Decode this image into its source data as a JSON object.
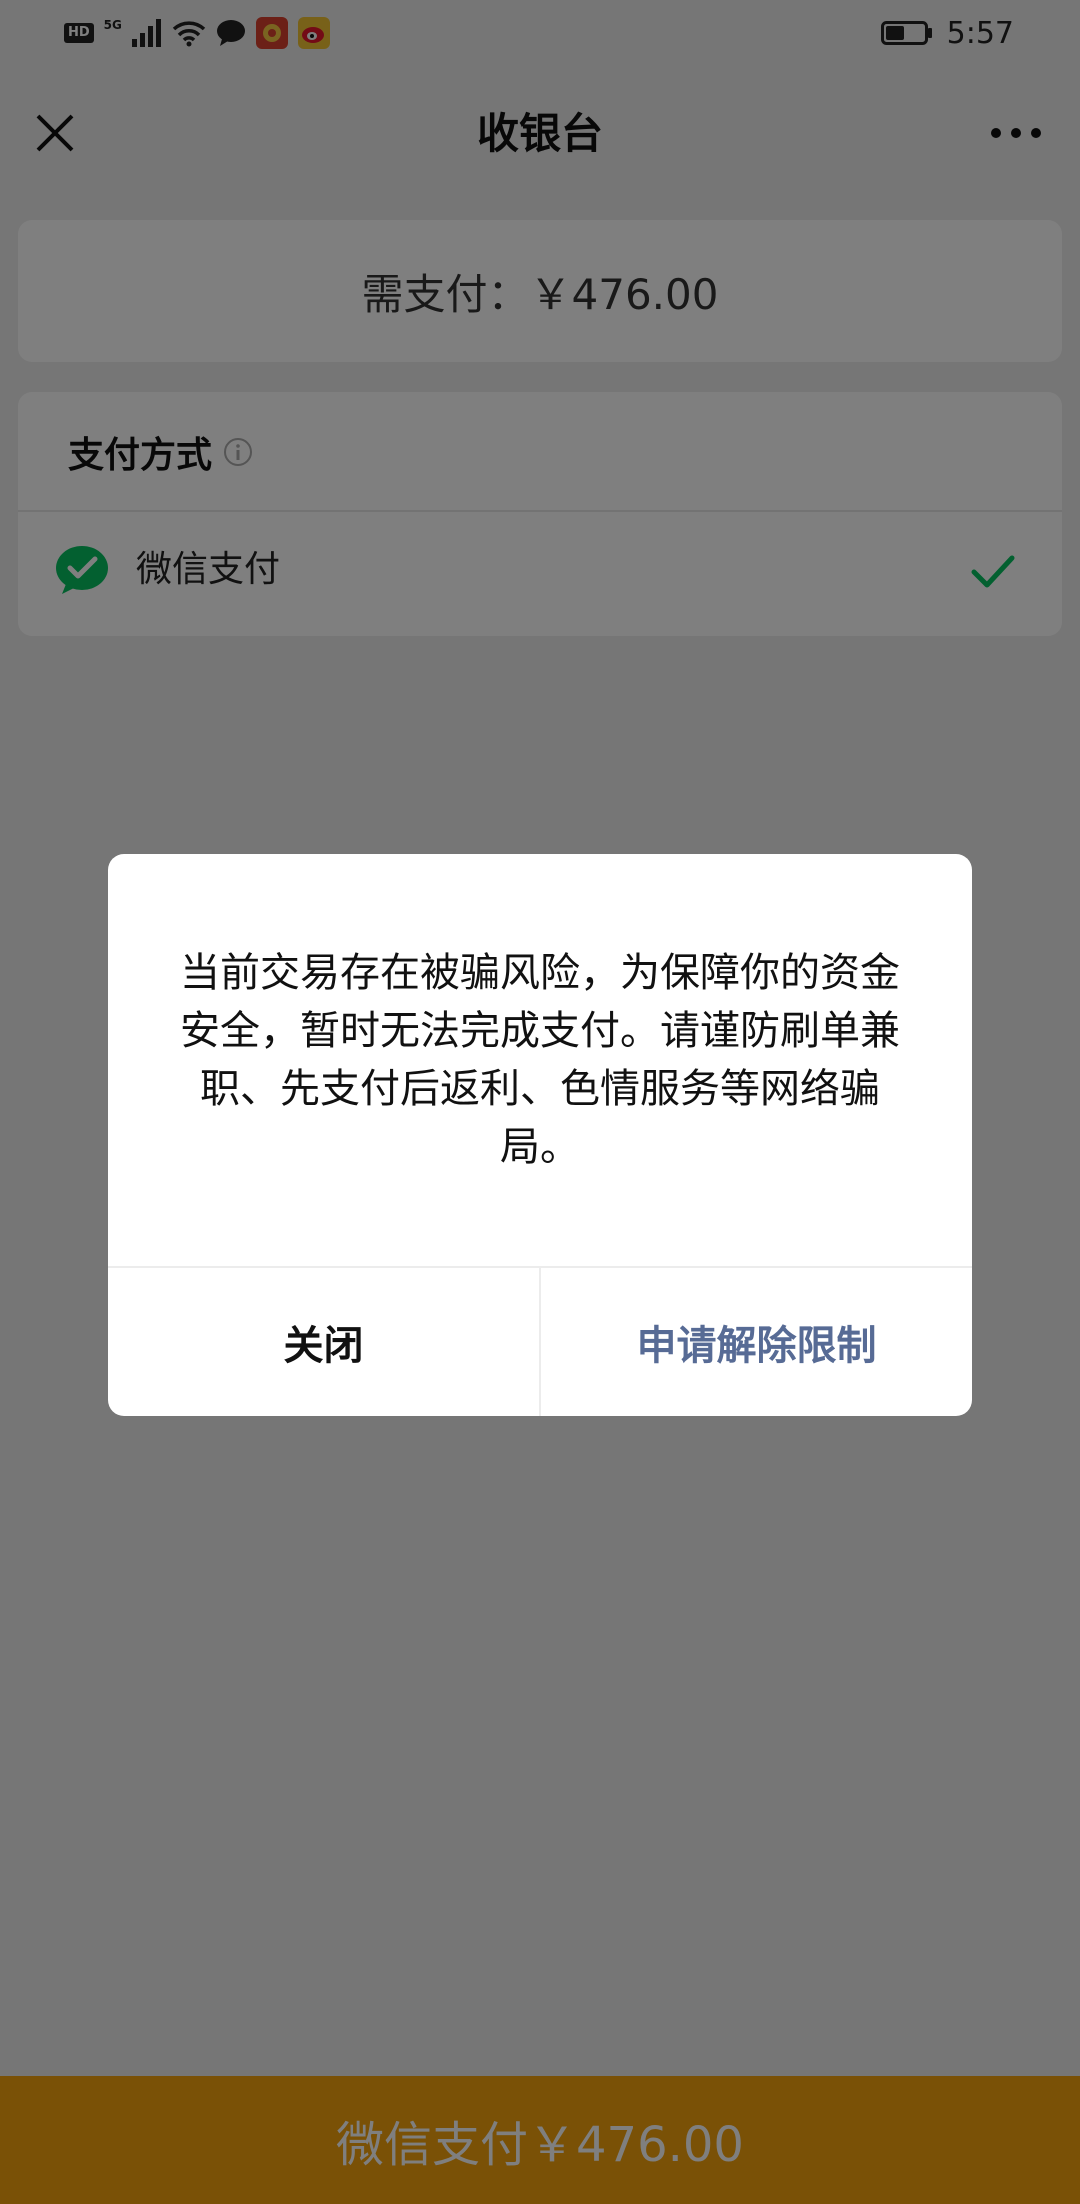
{
  "status_bar": {
    "hd_badge": "HD",
    "network": "5G",
    "time": "5:57"
  },
  "navbar": {
    "title": "收银台"
  },
  "amount": {
    "text": "需支付：￥476.00"
  },
  "payment_method": {
    "title": "支付方式",
    "option": "微信支付"
  },
  "dialog": {
    "message": "当前交易存在被骗风险，为保障你的资金安全，暂时无法完成支付。请谨防刷单兼职、先支付后返利、色情服务等网络骗局。",
    "close_label": "关闭",
    "unlock_label": "申请解除限制"
  },
  "pay_button": {
    "label": "微信支付￥476.00"
  },
  "colors": {
    "pay_bar": "#f4a30c",
    "link": "#576b95",
    "wechat_green": "#07c160"
  }
}
